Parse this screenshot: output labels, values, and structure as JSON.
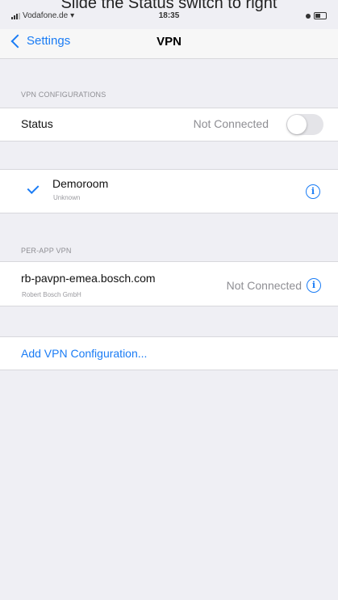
{
  "instruction": "Slide the Status switch to right",
  "status_bar": {
    "carrier": "Vodafone.de",
    "time": "18:35"
  },
  "nav": {
    "back_label": "Settings",
    "title": "VPN"
  },
  "vpn_configurations": {
    "header": "VPN CONFIGURATIONS",
    "status_label": "Status",
    "status_value": "Not Connected",
    "status_toggle_on": false
  },
  "configs": [
    {
      "name": "Demoroom",
      "subtitle": "Unknown",
      "selected": true
    }
  ],
  "per_app_vpn": {
    "header": "PER-APP VPN",
    "items": [
      {
        "name": "rb-pavpn-emea.bosch.com",
        "subtitle": "Robert Bosch GmbH",
        "status": "Not Connected"
      }
    ]
  },
  "add_config_label": "Add VPN Configuration..."
}
